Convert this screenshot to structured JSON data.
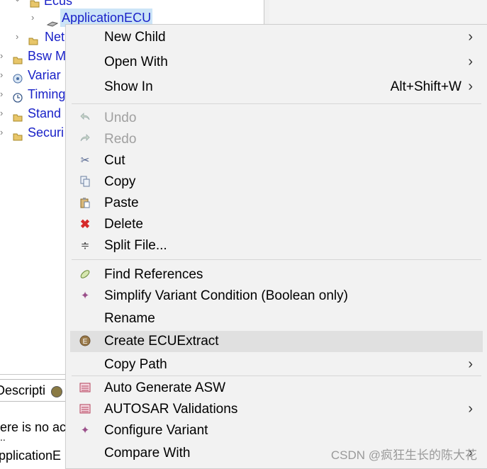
{
  "tree": {
    "items": [
      {
        "label": "Ecus",
        "icon": "folder-icon"
      },
      {
        "label": "ApplicationECU",
        "icon": "ecu-icon"
      },
      {
        "label": "Net",
        "icon": "folder-icon"
      },
      {
        "label": "Bsw M",
        "icon": "folder-icon"
      },
      {
        "label": "Variar",
        "icon": "variant-icon"
      },
      {
        "label": "Timing",
        "icon": "clock-icon"
      },
      {
        "label": "Stand",
        "icon": "folder-icon"
      },
      {
        "label": "Securi",
        "icon": "folder-icon"
      }
    ]
  },
  "bottom": {
    "tab_label": "Descripti",
    "line1": "ere is no ac",
    "line2": "..",
    "line3": "pplicationE"
  },
  "menu": {
    "items": [
      {
        "label": "New Child",
        "submenu": true
      },
      {
        "label": "Open With",
        "submenu": true
      },
      {
        "label": "Show In",
        "accelerator": "Alt+Shift+W",
        "submenu": true
      },
      {
        "label": "Undo",
        "disabled": true,
        "icon": "undo-icon"
      },
      {
        "label": "Redo",
        "disabled": true,
        "icon": "redo-icon"
      },
      {
        "label": "Cut",
        "icon": "scissors-icon"
      },
      {
        "label": "Copy",
        "icon": "copy-icon"
      },
      {
        "label": "Paste",
        "icon": "paste-icon"
      },
      {
        "label": "Delete",
        "icon": "delete-icon"
      },
      {
        "label": "Split File...",
        "icon": "split-icon"
      },
      {
        "label": "Find References",
        "icon": "find-references-icon"
      },
      {
        "label": "Simplify Variant Condition (Boolean only)",
        "icon": "variant-star-icon"
      },
      {
        "label": "Rename"
      },
      {
        "label": "Create ECUExtract",
        "icon": "ecu-extract-icon",
        "hover": true
      },
      {
        "label": "Copy Path",
        "submenu": true
      },
      {
        "label": "Auto Generate ASW",
        "icon": "autosar-generate-icon"
      },
      {
        "label": "AUTOSAR Validations",
        "icon": "autosar-validate-icon",
        "submenu": true
      },
      {
        "label": "Configure Variant",
        "icon": "variant-star-icon"
      },
      {
        "label": "Compare With",
        "submenu": true
      }
    ]
  },
  "watermark": "CSDN @疯狂生长的陈大花"
}
